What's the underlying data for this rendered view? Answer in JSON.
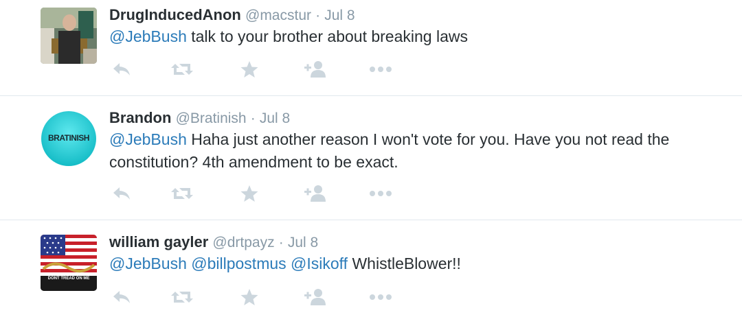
{
  "tweets": [
    {
      "fullname": "DrugInducedAnon",
      "handle": "@macstur",
      "separator": "·",
      "date": "Jul 8",
      "segments": [
        {
          "type": "mention",
          "text": "@JebBush"
        },
        {
          "type": "text",
          "text": " talk to your brother about breaking laws"
        }
      ]
    },
    {
      "fullname": "Brandon",
      "handle": "@Bratinish",
      "separator": "·",
      "date": "Jul 8",
      "avatar_text": "BRATINISH",
      "segments": [
        {
          "type": "mention",
          "text": "@JebBush"
        },
        {
          "type": "text",
          "text": " Haha just another reason I won't vote for you. Have you not read the constitution? 4th amendment to be exact."
        }
      ]
    },
    {
      "fullname": "william gayler",
      "handle": "@drtpayz",
      "separator": "·",
      "date": "Jul 8",
      "avatar_text": "DONT TREAD ON ME",
      "segments": [
        {
          "type": "mention",
          "text": "@JebBush"
        },
        {
          "type": "text",
          "text": " "
        },
        {
          "type": "mention",
          "text": "@billpostmus"
        },
        {
          "type": "text",
          "text": " "
        },
        {
          "type": "mention",
          "text": "@Isikoff"
        },
        {
          "type": "text",
          "text": " WhistleBlower!!"
        }
      ]
    }
  ],
  "actions": [
    "reply-icon",
    "retweet-icon",
    "favorite-icon",
    "follow-icon",
    "more-icon"
  ],
  "colors": {
    "mention": "#2b7bb9",
    "text": "#292f33",
    "meta": "#8899a6",
    "icon": "#ccd6dd",
    "divider": "#e1e8ed",
    "teal_avatar": "#1ec8d0"
  }
}
